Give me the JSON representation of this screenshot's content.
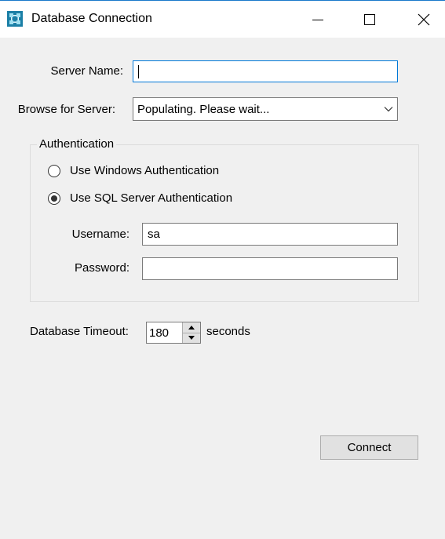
{
  "window": {
    "title": "Database Connection",
    "icon": "database-app-icon",
    "controls": [
      "minimize-icon",
      "maximize-icon",
      "close-icon"
    ]
  },
  "form": {
    "server_name_label": "Server Name:",
    "server_name_value": "",
    "browse_label": "Browse for Server:",
    "browse_value": "Populating. Please wait...",
    "authentication": {
      "title": "Authentication",
      "windows_auth_label": "Use Windows Authentication",
      "sql_auth_label": "Use SQL Server Authentication",
      "selected": "sql",
      "username_label": "Username:",
      "username_value": "sa",
      "password_label": "Password:",
      "password_value": ""
    },
    "timeout_label": "Database Timeout:",
    "timeout_value": "180",
    "timeout_unit": "seconds",
    "connect_label": "Connect"
  },
  "colors": {
    "accent": "#0078d7",
    "background": "#f0f0f0",
    "titlebar": "#ffffff"
  }
}
